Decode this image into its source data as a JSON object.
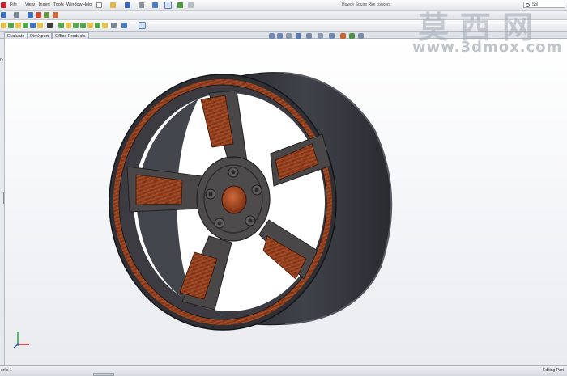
{
  "title_bar": {
    "menus": [
      "File",
      "View",
      "Insert",
      "Tools",
      "Window",
      "Help"
    ],
    "document_title": "Howdy Squire Rim concept",
    "search_text": "Sol"
  },
  "tabs": [
    "Evaluate",
    "DimXpert",
    "Office Products"
  ],
  "side_marks": [
    "D"
  ],
  "watermark": {
    "logo": "莫西网",
    "url": "www.3dmox.com"
  },
  "status_bar": {
    "left_text": "orks 1",
    "right_text": "Editing Part"
  },
  "colors": {
    "rim_dark": "#3a3a40",
    "barrel_dark": "#2e2f36",
    "spoke_gray": "#4a4748",
    "wood": "#8a3d1f",
    "wood_light": "#b2552c",
    "accent_blue": "#2c5fa8"
  },
  "icons": [
    "search-icon",
    "triad-icon"
  ]
}
